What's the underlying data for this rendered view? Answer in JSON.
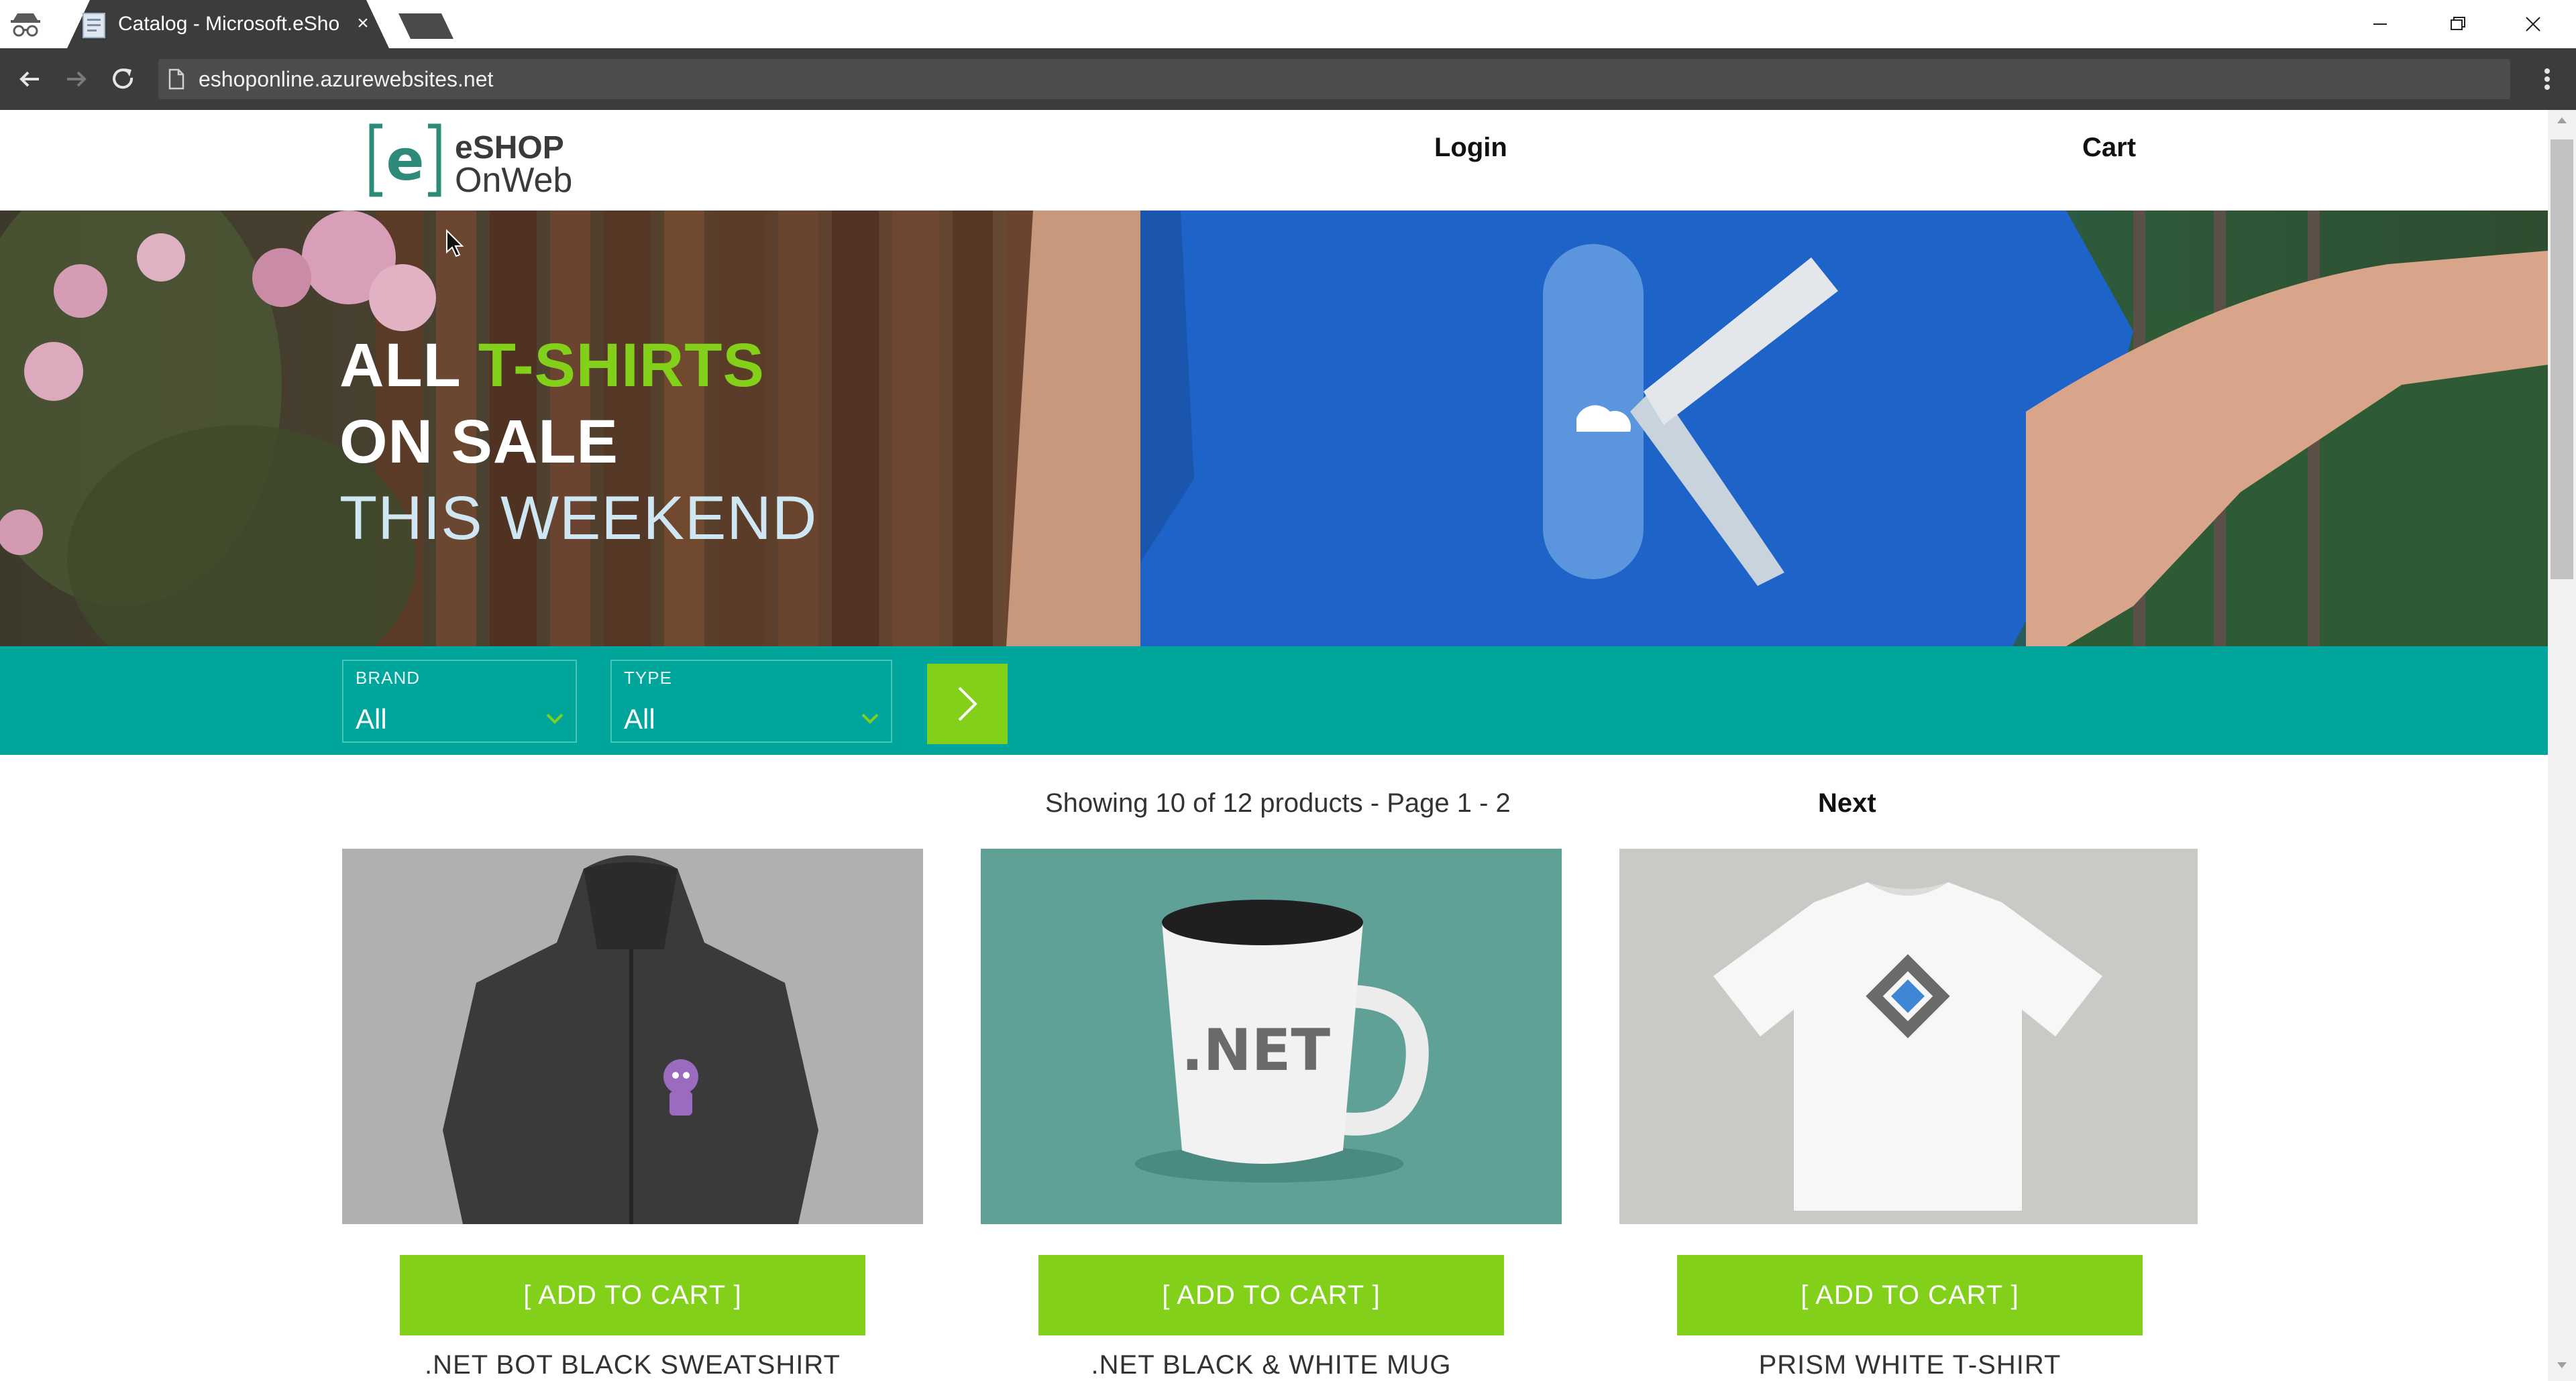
{
  "browser": {
    "tab_title": "Catalog - Microsoft.eSho",
    "tab_close": "×",
    "url": "eshoponline.azurewebsites.net",
    "icons": [
      "incognito-icon",
      "document-icon",
      "close-icon",
      "back-arrow-icon",
      "forward-arrow-icon",
      "reload-icon",
      "page-info-icon",
      "kebab-menu-icon",
      "minimize-icon",
      "restore-icon",
      "window-close-icon"
    ]
  },
  "header": {
    "logo_line1": "eSHOP",
    "logo_line2": "OnWeb",
    "login": "Login",
    "cart": "Cart"
  },
  "hero": {
    "line1_part1": "ALL ",
    "line1_part2": "T-SHIRTS",
    "line2": "ON SALE",
    "line3": "THIS WEEKEND"
  },
  "filters": {
    "brand": {
      "label": "BRAND",
      "value": "All"
    },
    "type": {
      "label": "TYPE",
      "value": "All"
    },
    "apply_icon": "chevron-right-icon"
  },
  "pager": {
    "summary": "Showing 10 of 12 products - Page 1 - 2",
    "next": "Next"
  },
  "products": [
    {
      "name": ".NET BOT BLACK SWEATSHIRT",
      "button": "[ ADD TO CART ]"
    },
    {
      "name": ".NET BLACK & WHITE MUG",
      "button": "[ ADD TO CART ]",
      "mug_text": ".NET"
    },
    {
      "name": "PRISM WHITE T-SHIRT",
      "button": "[ ADD TO CART ]"
    }
  ],
  "colors": {
    "brand_green": "#83d01b",
    "filter_teal": "#00a69c",
    "chrome_dark": "#3c3c3c"
  }
}
